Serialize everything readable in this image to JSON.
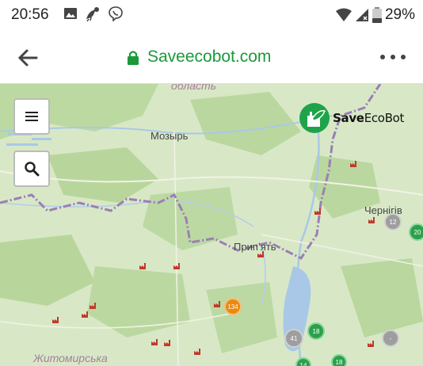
{
  "status_bar": {
    "time": "20:56",
    "battery": "29%",
    "icons": [
      "image-icon",
      "bird-icon",
      "viber-icon",
      "wifi-icon",
      "signal-icon",
      "battery-icon"
    ]
  },
  "browser": {
    "url": "Saveecobot.com",
    "back_icon": "back-arrow-icon",
    "menu_icon": "more-dots-icon",
    "lock_icon": "lock-icon"
  },
  "map": {
    "logo_text_a": "Save",
    "logo_text_b": "EcoBot",
    "controls": {
      "menu_icon": "hamburger-icon",
      "search_icon": "search-icon"
    },
    "labels": {
      "region_top": "область",
      "mozyr": "Мозырь",
      "pripyat": "Припʼять",
      "chernihiv": "Чернігів",
      "zhytomyr_region": "Житомирська"
    },
    "clusters": [
      {
        "label": "134",
        "color": "#e88a10"
      },
      {
        "label": "12",
        "color": "#9e9e9e"
      },
      {
        "label": "20",
        "color": "#2aa14a"
      },
      {
        "label": "18",
        "color": "#2aa14a"
      },
      {
        "label": "41",
        "color": "#9e9e9e"
      },
      {
        "label": "-",
        "color": "#9e9e9e"
      },
      {
        "label": "18",
        "color": "#2aa14a"
      },
      {
        "label": "14",
        "color": "#2aa14a"
      }
    ],
    "colors": {
      "water": "#a9c8e8",
      "border": "#9a7fb5",
      "forest": "#b9d89e",
      "land": "#d7e8c4"
    }
  }
}
